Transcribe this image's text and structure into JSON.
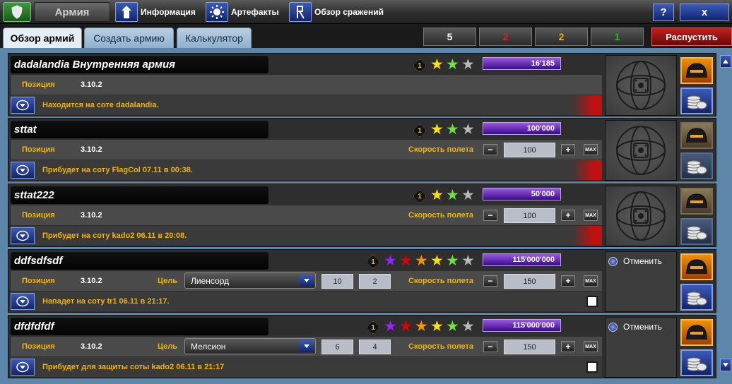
{
  "app": {
    "title": "Армия"
  },
  "nav": [
    {
      "label": "Информация",
      "icon": "info-icon"
    },
    {
      "label": "Артефакты",
      "icon": "artifact-sun-icon"
    },
    {
      "label": "Обзор сражений",
      "icon": "battle-rune-icon"
    }
  ],
  "window": {
    "help_label": "?",
    "close_label": "x"
  },
  "tabs": [
    {
      "label": "Обзор армий",
      "active": true
    },
    {
      "label": "Создать армию",
      "active": false
    },
    {
      "label": "Калькулятор",
      "active": false
    }
  ],
  "filters": [
    {
      "label": "5",
      "color": "#ffffff"
    },
    {
      "label": "2",
      "color": "#e02020"
    },
    {
      "label": "2",
      "color": "#f0b400"
    },
    {
      "label": "1",
      "color": "#20c020"
    }
  ],
  "disband_label": "Распустить",
  "labels": {
    "position": "Позиция",
    "speed": "Скорость полета",
    "target": "Цель",
    "cancel": "Отменить",
    "max": "MAX",
    "minus": "−",
    "plus": "+"
  },
  "colors": {
    "star_yellow": "#ffe000",
    "star_green": "#70e040",
    "star_gray": "#b8b8b8",
    "star_purple": "#9a20ff",
    "star_red": "#e00000",
    "star_orange": "#ff9000",
    "label_gold": "#f0b400"
  },
  "armies": [
    {
      "name": "dadalandia Внутренняя армия",
      "level": "1",
      "stars": [
        "yellow",
        "green",
        "gray"
      ],
      "strength": "16'185",
      "position": "3.10.2",
      "status": "Находится на соте dadalandia.",
      "has_speed": false,
      "speed": "",
      "has_target": false,
      "target": "",
      "coord1": "",
      "coord2": "",
      "cancellable": false
    },
    {
      "name": "sttat",
      "level": "1",
      "stars": [
        "yellow",
        "green",
        "gray"
      ],
      "strength": "100'000",
      "position": "3.10.2",
      "status": "Прибудет на соту FlagCol 07.11 в 00:38.",
      "has_speed": true,
      "speed": "100",
      "has_target": false,
      "target": "",
      "coord1": "",
      "coord2": "",
      "cancellable": false
    },
    {
      "name": "sttat222",
      "level": "1",
      "stars": [
        "yellow",
        "green",
        "gray"
      ],
      "strength": "50'000",
      "position": "3.10.2",
      "status": "Прибудет на соту kado2 06.11 в 20:08.",
      "has_speed": true,
      "speed": "100",
      "has_target": false,
      "target": "",
      "coord1": "",
      "coord2": "",
      "cancellable": false
    },
    {
      "name": "ddfsdfsdf",
      "level": "1",
      "stars": [
        "purple",
        "red",
        "orange",
        "yellow",
        "green",
        "gray"
      ],
      "strength": "115'000'000",
      "position": "3.10.2",
      "status": "Нападет на соту tr1 06.11 в 21:17.",
      "has_speed": true,
      "speed": "150",
      "has_target": true,
      "target": "Лиенсорд",
      "coord1": "10",
      "coord2": "2",
      "cancellable": true
    },
    {
      "name": "dfdfdfdf",
      "level": "1",
      "stars": [
        "purple",
        "red",
        "orange",
        "yellow",
        "green",
        "gray"
      ],
      "strength": "115'000'000",
      "position": "3.10.2",
      "status": "Прибудет для защиты соты kado2  06.11 в 21:17",
      "has_speed": true,
      "speed": "150",
      "has_target": true,
      "target": "Мелсион",
      "coord1": "6",
      "coord2": "4",
      "cancellable": true
    }
  ]
}
